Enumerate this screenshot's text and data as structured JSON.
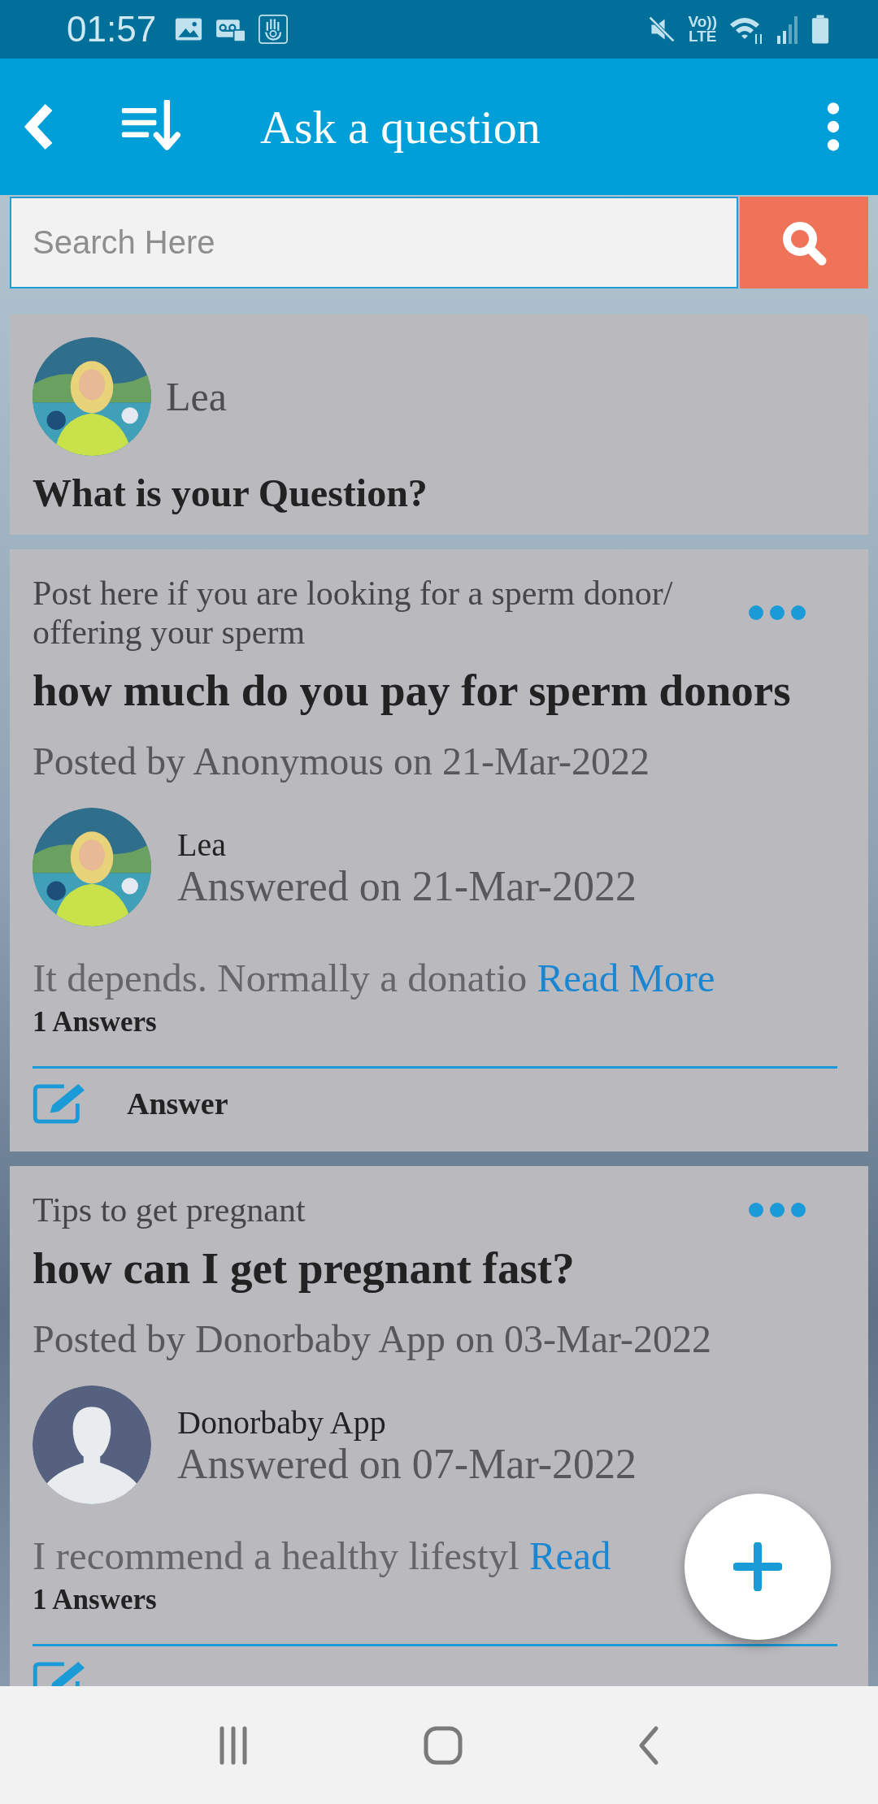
{
  "status_bar": {
    "time": "01:57",
    "network_label": [
      "Vo))",
      "LTE"
    ]
  },
  "toolbar": {
    "title": "Ask a question"
  },
  "search": {
    "placeholder": "Search Here"
  },
  "composer": {
    "user": "Lea",
    "prompt": "What is your Question?"
  },
  "posts": [
    {
      "category": "Post here if you are looking for a sperm donor/ offering your sperm",
      "question": "how much do you pay for sperm donors",
      "posted": "Posted by Anonymous on 21-Mar-2022",
      "answer": {
        "name": "Lea",
        "date": "Answered on 21-Mar-2022",
        "excerpt": "It depends. Normally a donatio",
        "link": "Read More"
      },
      "count": "1 Answers",
      "action": "Answer"
    },
    {
      "category": "Tips to get pregnant",
      "question": "how can I get pregnant fast?",
      "posted": "Posted by Donorbaby App on 03-Mar-2022",
      "answer": {
        "avatar": {
          "kind": "silhouette"
        },
        "name": "Donorbaby App",
        "date": "Answered on 07-Mar-2022",
        "excerpt": "I recommend a healthy lifestyl",
        "link": "Read"
      },
      "count": "1 Answers"
    }
  ]
}
